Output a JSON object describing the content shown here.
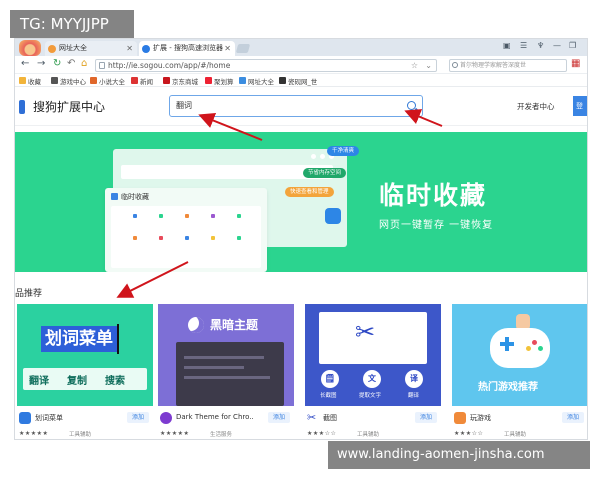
{
  "watermark": {
    "top_left": "TG: MYYJJPP",
    "bottom_right": "www.landing-aomen-jinsha.com"
  },
  "browser": {
    "tabs": [
      {
        "label": "网址大全",
        "active": false
      },
      {
        "label": "扩展 - 搜狗高速浏览器",
        "active": true
      }
    ],
    "address": "http://ie.sogou.com/app/#/home",
    "search_placeholder": "首尔物理学家解答深度世",
    "bookmarks": [
      "收藏",
      "游戏中心",
      "小说大全",
      "新闻",
      "京东商城",
      "聚划算",
      "网址大全",
      "瓷砚网_世"
    ]
  },
  "page": {
    "brand": "搜狗扩展中心",
    "search_value": "翻词",
    "dev_link": "开发者中心",
    "login": "登"
  },
  "banner": {
    "title": "临时收藏",
    "subtitle": "网页一键暂存  一键恢复",
    "mock_title": "临时收藏",
    "pills": [
      "千净清爽",
      "节省内存空间",
      "快速查看和管理"
    ],
    "accent": "#2bd48f"
  },
  "section": {
    "title": "品推荐"
  },
  "cards": [
    {
      "art": {
        "highlight": "划词菜单",
        "words": [
          "翻译",
          "复制",
          "搜索"
        ]
      },
      "name": "划词菜单",
      "add": "添加",
      "stars": "★★★★★",
      "category": "工具辅助"
    },
    {
      "art": {
        "title": "黑暗主题"
      },
      "name": "Dark Theme for Chro...",
      "add": "添加",
      "stars": "★★★★★",
      "category": "生活服务"
    },
    {
      "art": {
        "labels": [
          "长截图",
          "提取文字",
          "翻译"
        ],
        "glyphs": [
          "🗒",
          "文",
          "译"
        ]
      },
      "name": "截图",
      "add": "添加",
      "stars": "★★★☆☆",
      "category": "工具辅助"
    },
    {
      "art": {
        "title": "热门游戏推荐"
      },
      "name": "玩游戏",
      "add": "添加",
      "stars": "★★★☆☆",
      "category": "工具辅助"
    }
  ]
}
